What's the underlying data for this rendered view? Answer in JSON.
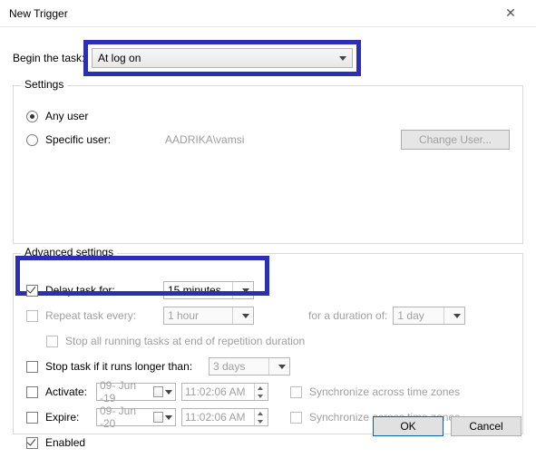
{
  "window": {
    "title": "New Trigger"
  },
  "begin": {
    "label": "Begin the task:",
    "value": "At log on"
  },
  "settings": {
    "legend": "Settings",
    "any_user_label": "Any user",
    "specific_user_label": "Specific user:",
    "specific_user_value": "AADRIKA\\vamsi",
    "change_user_btn": "Change User..."
  },
  "advanced": {
    "legend": "Advanced settings",
    "delay_label": "Delay task for:",
    "delay_value": "15 minutes",
    "repeat_label": "Repeat task every:",
    "repeat_value": "1 hour",
    "duration_label": "for a duration of:",
    "duration_value": "1 day",
    "stop_running_label": "Stop all running tasks at end of repetition duration",
    "stop_longer_label": "Stop task if it runs longer than:",
    "stop_longer_value": "3 days",
    "activate_label": "Activate:",
    "activate_date": "09- Jun -19",
    "activate_time": "11:02:06 AM",
    "expire_label": "Expire:",
    "expire_date": "09- Jun -20",
    "expire_time": "11:02:06 AM",
    "sync_label": "Synchronize across time zones",
    "enabled_label": "Enabled"
  },
  "buttons": {
    "ok": "OK",
    "cancel": "Cancel"
  }
}
